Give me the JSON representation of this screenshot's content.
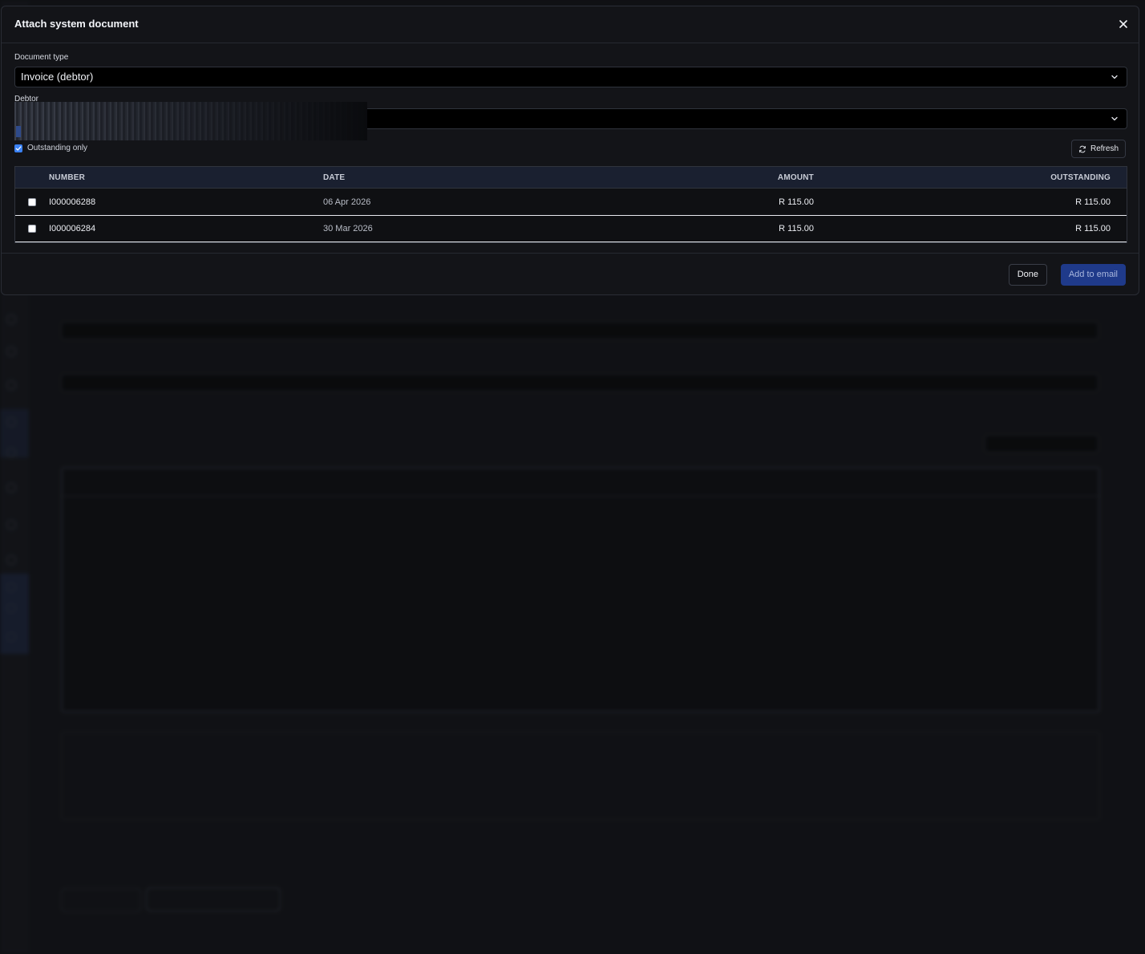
{
  "modal": {
    "title": "Attach system document",
    "close_icon": "close-icon",
    "document_type": {
      "label": "Document type",
      "value": "Invoice (debtor)"
    },
    "debtor": {
      "label": "Debtor",
      "value": ""
    },
    "outstanding_only": {
      "label": "Outstanding only",
      "checked": true
    },
    "refresh_label": "Refresh",
    "table": {
      "columns": [
        "NUMBER",
        "DATE",
        "AMOUNT",
        "OUTSTANDING"
      ],
      "rows": [
        {
          "number": "I000006288",
          "date": "06 Apr 2026",
          "amount": "R 115.00",
          "outstanding": "R 115.00",
          "selected": false
        },
        {
          "number": "I000006284",
          "date": "30 Mar 2026",
          "amount": "R 115.00",
          "outstanding": "R 115.00",
          "selected": false
        }
      ]
    },
    "done_label": "Done",
    "add_label": "Add to email"
  },
  "colors": {
    "accent": "#3b82f6",
    "primary_button": "#1f3a8a",
    "table_header": "#1a2030",
    "modal_bg": "#131418"
  }
}
